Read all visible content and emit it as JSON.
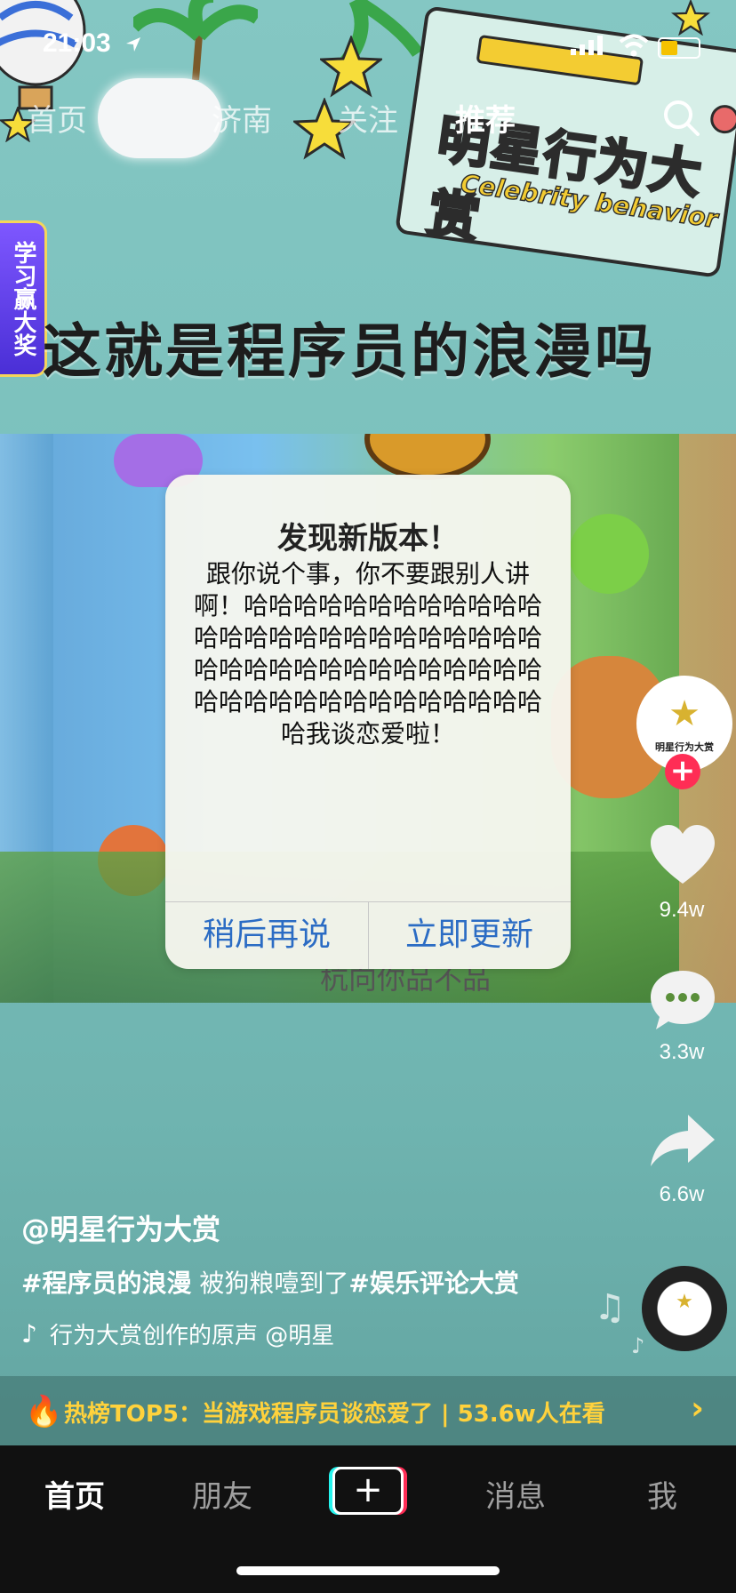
{
  "status_bar": {
    "time": "21:03"
  },
  "top_nav": {
    "tabs": [
      "首页",
      "济南",
      "关注",
      "推荐"
    ],
    "active": "推荐"
  },
  "badge": {
    "title": "明星行为大赏",
    "subtitle": "Celebrity behavior"
  },
  "side_tag": "学习赢大奖",
  "headline": "这就是程序员的浪漫吗",
  "dialog": {
    "title": "发现新版本！",
    "body": "跟你说个事，你不要跟别人讲啊！哈哈哈哈哈哈哈哈哈哈哈哈哈哈哈哈哈哈哈哈哈哈哈哈哈哈哈哈哈哈哈哈哈哈哈哈哈哈哈哈哈哈哈哈哈哈哈哈哈哈哈哈哈哈哈我谈恋爱啦！",
    "left_button": "稍后再说",
    "right_button": "立即更新"
  },
  "video_behind_text": "杭向你品不品",
  "rail": {
    "avatar_text": "明星行为大赏",
    "likes": "9.4w",
    "comments": "3.3w",
    "shares": "6.6w"
  },
  "caption": {
    "author": "@明星行为大赏",
    "tag1": "#程序员的浪漫",
    "text": " 被狗粮噎到了",
    "tag2": "#娱乐评论大赏",
    "music": "行为大赏创作的原声    @明星"
  },
  "hot": {
    "text": "热榜TOP5：当游戏程序员谈恋爱了 | 53.6w人在看"
  },
  "bottom_nav": {
    "home": "首页",
    "friends": "朋友",
    "plus": "+",
    "messages": "消息",
    "me": "我"
  },
  "colors": {
    "accent_red": "#ff2d55",
    "link_blue": "#2b6cc4",
    "hot_yellow": "#ffd23c"
  }
}
